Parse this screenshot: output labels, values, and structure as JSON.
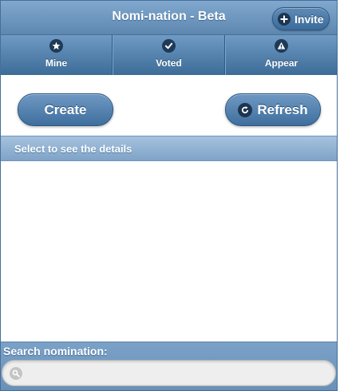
{
  "header": {
    "title": "Nomi-nation - Beta",
    "invite_label": "Invite"
  },
  "nav": {
    "tabs": [
      {
        "label": "Mine",
        "icon": "star-icon"
      },
      {
        "label": "Voted",
        "icon": "check-icon"
      },
      {
        "label": "Appear",
        "icon": "alert-icon"
      }
    ]
  },
  "actions": {
    "create_label": "Create",
    "refresh_label": "Refresh"
  },
  "list": {
    "header": "Select to see the details",
    "items": []
  },
  "search": {
    "label": "Search nomination:",
    "value": "",
    "placeholder": ""
  },
  "colors": {
    "header_gradient_top": "#81a8ce",
    "header_gradient_bottom": "#5e87b0",
    "button_blue": "#3f6f9e",
    "icon_disc": "#1d3550",
    "divider_bar": "#8fb0d2"
  }
}
